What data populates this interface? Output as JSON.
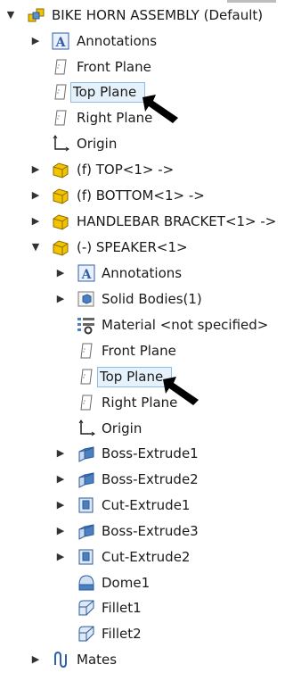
{
  "tree": {
    "root": {
      "label": "BIKE HORN ASSEMBLY  (Default)",
      "icon": "assembly-icon"
    },
    "items": [
      {
        "label": "Annotations",
        "icon": "annotations-icon"
      },
      {
        "label": "Front Plane",
        "icon": "plane-icon"
      },
      {
        "label": "Top Plane",
        "icon": "plane-icon",
        "selected": true
      },
      {
        "label": "Right Plane",
        "icon": "plane-icon"
      },
      {
        "label": "Origin",
        "icon": "origin-icon"
      },
      {
        "label": "(f) TOP<1> ->",
        "icon": "part-icon"
      },
      {
        "label": "(f) BOTTOM<1> ->",
        "icon": "part-icon"
      },
      {
        "label": "HANDLEBAR BRACKET<1> ->",
        "icon": "part-icon"
      },
      {
        "label": "(-) SPEAKER<1>",
        "icon": "part-icon",
        "expanded": true
      },
      {
        "label": "Annotations",
        "icon": "annotations-icon"
      },
      {
        "label": "Solid Bodies(1)",
        "icon": "solid-bodies-icon"
      },
      {
        "label": "Material <not specified>",
        "icon": "material-icon"
      },
      {
        "label": "Front Plane",
        "icon": "plane-icon"
      },
      {
        "label": "Top Plane",
        "icon": "plane-icon",
        "selected": true
      },
      {
        "label": "Right Plane",
        "icon": "plane-icon"
      },
      {
        "label": "Origin",
        "icon": "origin-icon"
      },
      {
        "label": "Boss-Extrude1",
        "icon": "boss-extrude-icon"
      },
      {
        "label": "Boss-Extrude2",
        "icon": "boss-extrude-icon"
      },
      {
        "label": "Cut-Extrude1",
        "icon": "cut-extrude-icon"
      },
      {
        "label": "Boss-Extrude3",
        "icon": "boss-extrude-icon"
      },
      {
        "label": "Cut-Extrude2",
        "icon": "cut-extrude-icon"
      },
      {
        "label": "Dome1",
        "icon": "dome-icon"
      },
      {
        "label": "Fillet1",
        "icon": "fillet-icon"
      },
      {
        "label": "Fillet2",
        "icon": "fillet-icon"
      },
      {
        "label": "Mates",
        "icon": "mates-icon"
      }
    ]
  },
  "colors": {
    "selection_fill": "#e6f2fb",
    "selection_border": "#8fbde4",
    "part_yellow": "#f3c300",
    "annotation_blue": "#2f5fa8",
    "feature_blue": "#4a7fc0"
  }
}
